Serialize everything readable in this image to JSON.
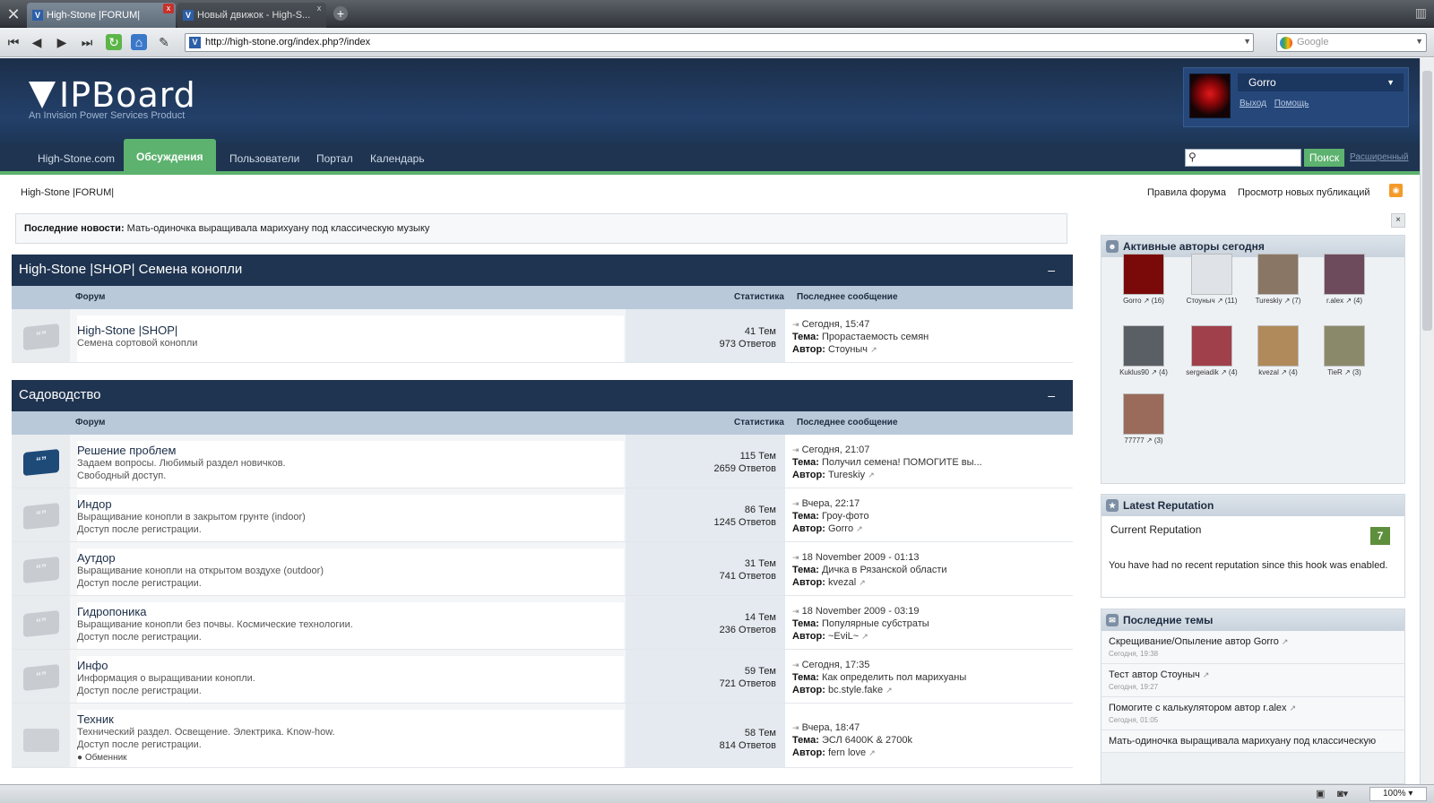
{
  "browser": {
    "tabs": [
      {
        "title": "High-Stone |FORUM|",
        "active": true
      },
      {
        "title": "Новый движок - High-S...",
        "active": false
      }
    ],
    "url": "http://high-stone.org/index.php?/index",
    "search_placeholder": "Google",
    "zoom": "100%"
  },
  "header": {
    "logo_text": "IPBoard",
    "logo_tagline": "An Invision Power Services Product",
    "username": "Gorro",
    "logout": "Выход",
    "help": "Помощь"
  },
  "nav": {
    "items": [
      "High-Stone.com",
      "Обсуждения",
      "Пользователи",
      "Портал",
      "Календарь"
    ],
    "search_button": "Поиск",
    "advanced": "Расширенный"
  },
  "breadcrumb": "High-Stone |FORUM|",
  "toplinks": [
    "Правила форума",
    "Просмотр новых публикаций"
  ],
  "news": {
    "label": "Последние новости:",
    "text": "Мать-одиночка выращивала марихуану под классическую музыку"
  },
  "columns": {
    "forum": "Форум",
    "stats": "Статистика",
    "last": "Последнее сообщение",
    "topic": "Тема:",
    "author": "Автор:"
  },
  "categories": [
    {
      "title": "High-Stone |SHOP| Семена конопли",
      "collapse": "–",
      "forums": [
        {
          "name": "High-Stone |SHOP|",
          "desc1": "Семена сортовой конопли",
          "desc2": "",
          "topics": "41 Тем",
          "replies": "973 Ответов",
          "date": "Сегодня, 15:47",
          "topic": "Прорастаемость семян",
          "author": "Стоуныч"
        }
      ]
    },
    {
      "title": "Садоводство",
      "collapse": "–",
      "forums": [
        {
          "name": "Решение проблем",
          "desc1": "Задаем вопросы. Любимый раздел новичков.",
          "desc2": "Свободный доступ.",
          "topics": "115 Тем",
          "replies": "2659 Ответов",
          "date": "Сегодня, 21:07",
          "topic": "Получил семена! ПОМОГИТЕ вы...",
          "author": "Tureskiy"
        },
        {
          "name": "Индор",
          "desc1": "Выращивание конопли в закрытом грунте (indoor)",
          "desc2": "Доступ после регистрации.",
          "topics": "86 Тем",
          "replies": "1245 Ответов",
          "date": "Вчера, 22:17",
          "topic": "Гроу-фото",
          "author": "Gorro"
        },
        {
          "name": "Аутдор",
          "desc1": "Выращивание конопли на открытом воздухе (outdoor)",
          "desc2": "Доступ после регистрации.",
          "topics": "31 Тем",
          "replies": "741 Ответов",
          "date": "18 November 2009 - 01:13",
          "topic": "Дичка в Рязанской области",
          "author": "kvezal"
        },
        {
          "name": "Гидропоника",
          "desc1": "Выращивание конопли без почвы. Космические технологии.",
          "desc2": "Доступ после регистрации.",
          "topics": "14 Тем",
          "replies": "236 Ответов",
          "date": "18 November 2009 - 03:19",
          "topic": "Популярные субстраты",
          "author": "~EviL~"
        },
        {
          "name": "Инфо",
          "desc1": "Информация о выращивании конопли.",
          "desc2": "Доступ после регистрации.",
          "topics": "59 Тем",
          "replies": "721 Ответов",
          "date": "Сегодня, 17:35",
          "topic": "Как определить пол марихуаны",
          "author": "bc.style.fake"
        },
        {
          "name": "Техник",
          "desc1": "Технический раздел. Освещение. Электрика. Know-how.",
          "desc2": "Доступ после регистрации.",
          "subforum": "Обменник",
          "topics": "58 Тем",
          "replies": "814 Ответов",
          "date": "Вчера, 18:47",
          "topic": "ЭСЛ 6400K & 2700k",
          "author": "fern love"
        }
      ]
    }
  ],
  "sidebar": {
    "active_authors_title": "Активные авторы сегодня",
    "authors": [
      {
        "name": "Gorro",
        "count": "(16)",
        "color": "#7a0a0a"
      },
      {
        "name": "Стоуныч",
        "count": "(11)",
        "color": "#dfe3e8"
      },
      {
        "name": "Tureskiy",
        "count": "(7)",
        "color": "#8a7664"
      },
      {
        "name": "r.alex",
        "count": "(4)",
        "color": "#6d4a5c"
      },
      {
        "name": "Kuklus90",
        "count": "(4)",
        "color": "#5a5f66"
      },
      {
        "name": "sergeiadik",
        "count": "(4)",
        "color": "#a0404a"
      },
      {
        "name": "kvezal",
        "count": "(4)",
        "color": "#b08a5a"
      },
      {
        "name": "TieR",
        "count": "(3)",
        "color": "#8a8a6a"
      },
      {
        "name": "77777",
        "count": "(3)",
        "color": "#9a6a5a"
      }
    ],
    "reputation_title": "Latest Reputation",
    "current_rep_label": "Current Reputation",
    "current_rep_value": "7",
    "rep_text": "You have had no recent reputation since this hook was enabled.",
    "latest_topics_title": "Последние темы",
    "latest_topics": [
      {
        "title": "Скрещивание/Опыление",
        "by": "автор",
        "author": "Gorro",
        "time": "Сегодня, 19:38"
      },
      {
        "title": "Тест",
        "by": "автор",
        "author": "Стоуныч",
        "time": "Сегодня, 19:27"
      },
      {
        "title": "Помогите с калькулятором",
        "by": "автор",
        "author": "r.alex",
        "time": "Сегодня, 01:05"
      },
      {
        "title": "Мать-одиночка выращивала марихуану под классическую",
        "by": "",
        "author": "",
        "time": ""
      }
    ]
  }
}
